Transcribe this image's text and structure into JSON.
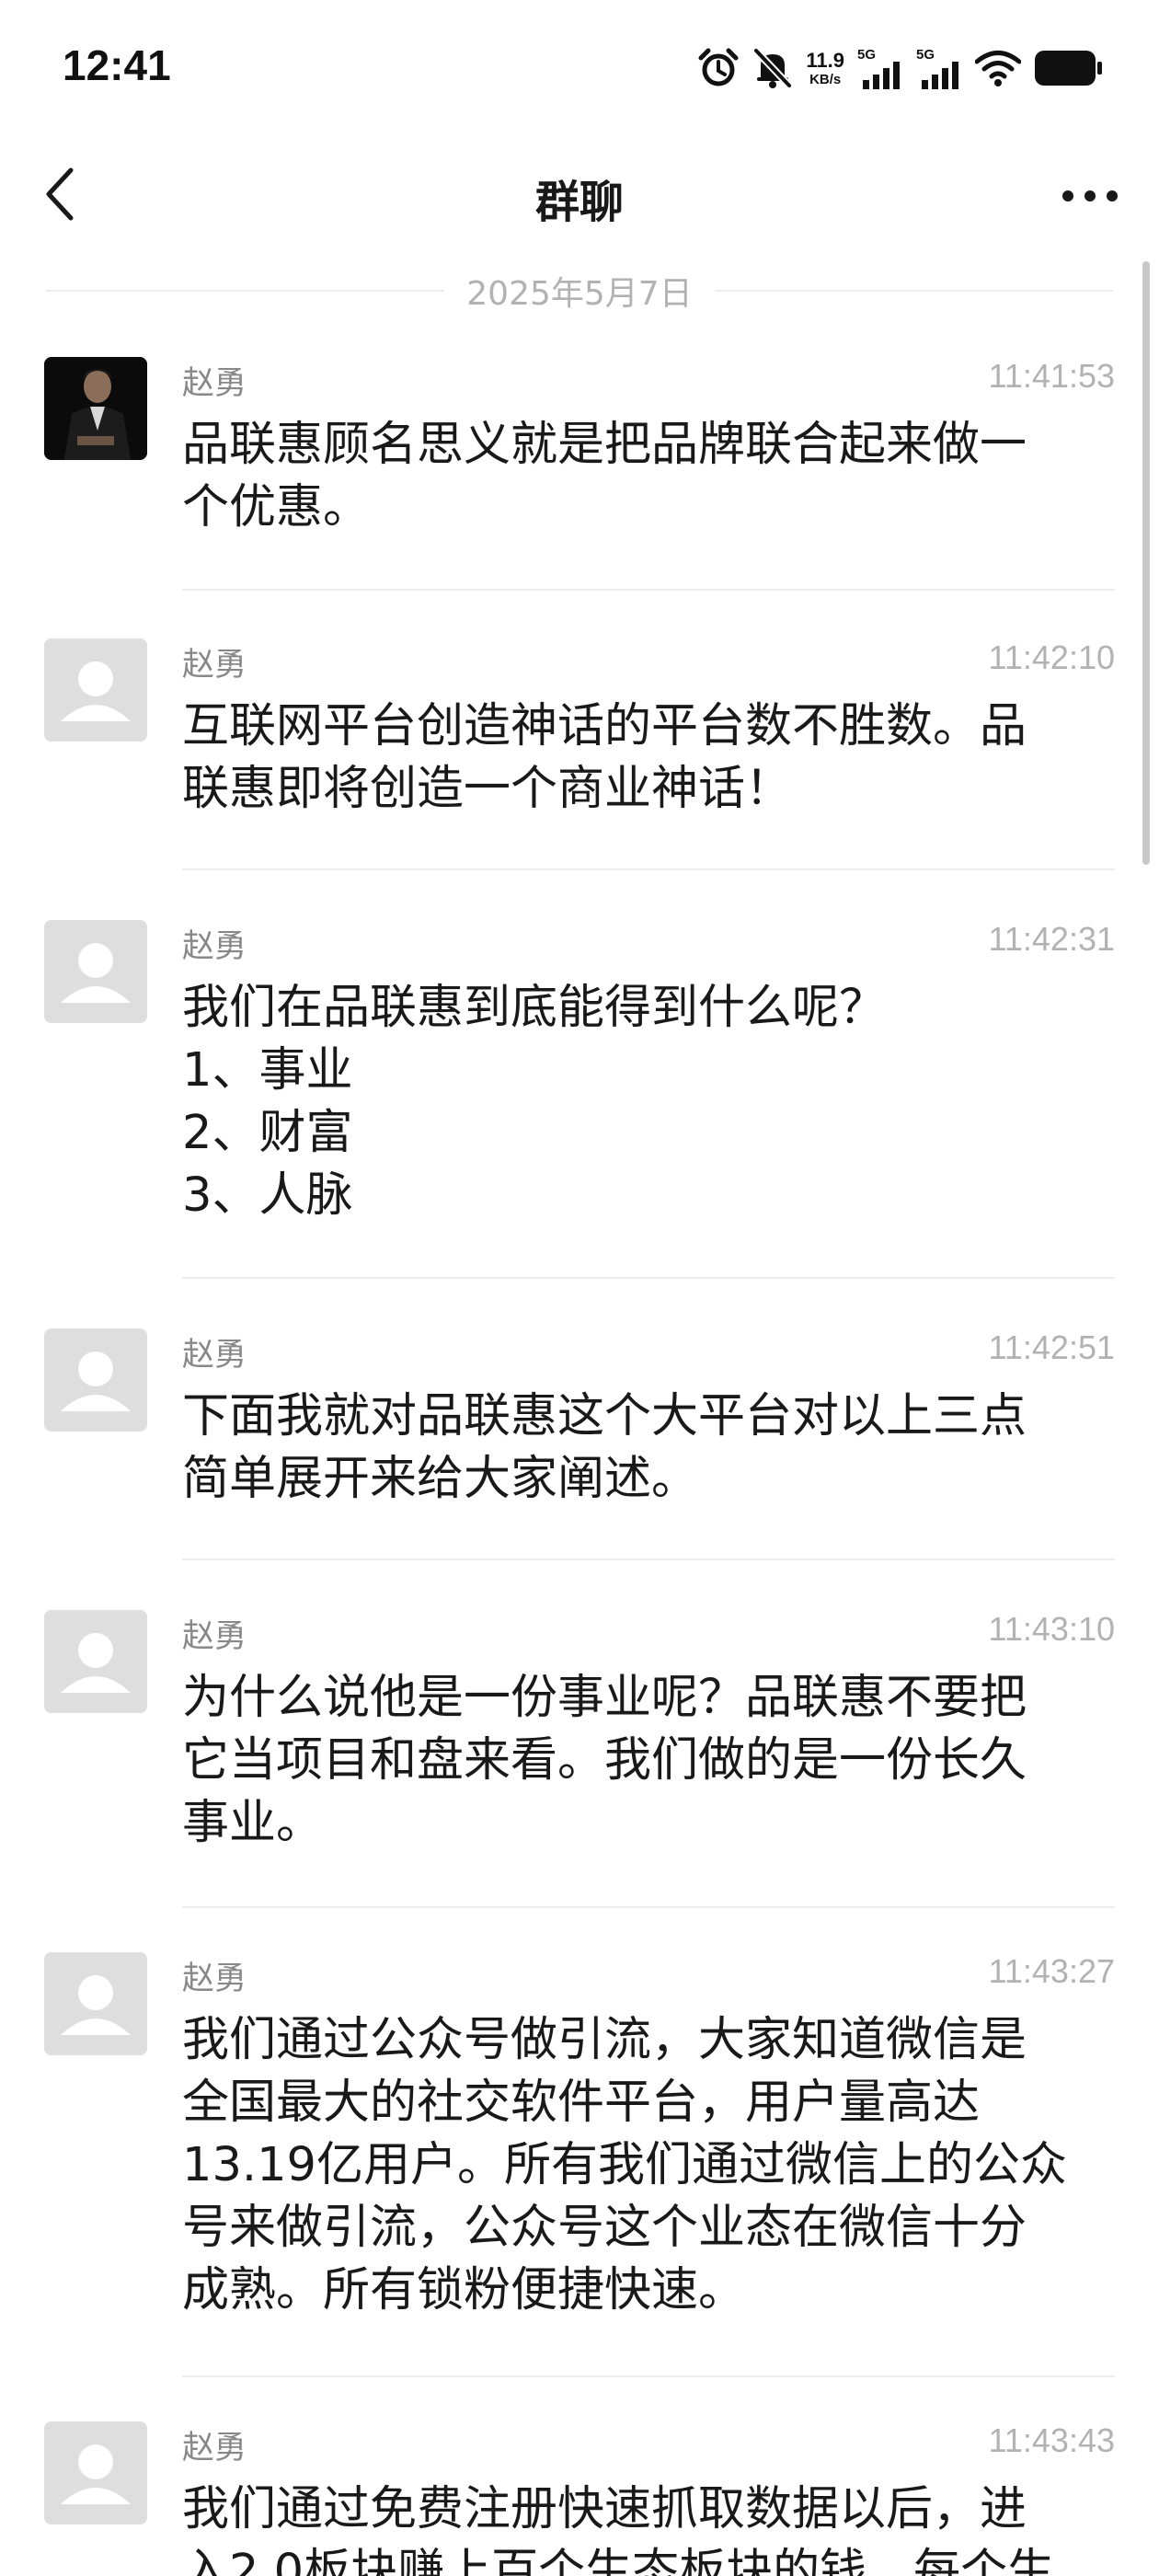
{
  "status_bar": {
    "time": "12:41",
    "net_speed_value": "11.9",
    "net_speed_unit": "KB/s",
    "sim1_label": "5G",
    "sim2_label": "5G",
    "icons": [
      "alarm-icon",
      "mute-bell-icon",
      "signal-icon",
      "signal-icon",
      "wifi-icon",
      "battery-icon"
    ]
  },
  "nav": {
    "title": "群聊",
    "back_icon": "chevron-left-icon",
    "more_icon": "more-dots-icon"
  },
  "chat": {
    "date": "2025年5月7日",
    "messages": [
      {
        "sender": "赵勇",
        "time": "11:41:53",
        "avatar": "photo",
        "text": "品联惠顾名思义就是把品牌联合起来做一\n个优惠。"
      },
      {
        "sender": "赵勇",
        "time": "11:42:10",
        "avatar": "default",
        "text": "互联网平台创造神话的平台数不胜数。品\n联惠即将创造一个商业神话！"
      },
      {
        "sender": "赵勇",
        "time": "11:42:31",
        "avatar": "default",
        "text": "我们在品联惠到底能得到什么呢？\n1、事业\n2、财富\n3、人脉"
      },
      {
        "sender": "赵勇",
        "time": "11:42:51",
        "avatar": "default",
        "text": "下面我就对品联惠这个大平台对以上三点\n简单展开来给大家阐述。"
      },
      {
        "sender": "赵勇",
        "time": "11:43:10",
        "avatar": "default",
        "text": "为什么说他是一份事业呢？品联惠不要把\n它当项目和盘来看。我们做的是一份长久\n事业。"
      },
      {
        "sender": "赵勇",
        "time": "11:43:27",
        "avatar": "default",
        "text": "我们通过公众号做引流，大家知道微信是\n全国最大的社交软件平台，用户量高达\n13.19亿用户。所有我们通过微信上的公众\n号来做引流，公众号这个业态在微信十分\n成熟。所有锁粉便捷快速。"
      },
      {
        "sender": "赵勇",
        "time": "11:43:43",
        "avatar": "default",
        "text": "我们通过免费注册快速抓取数据以后，进\n入2.0板块赚上百个生态板块的钱，每个生"
      }
    ]
  },
  "colors": {
    "background": "#ffffff",
    "text": "#191919",
    "secondary_text": "#888888",
    "timestamp": "#b2b2b2",
    "divider": "#ededed",
    "avatar_placeholder": "#dedede"
  }
}
